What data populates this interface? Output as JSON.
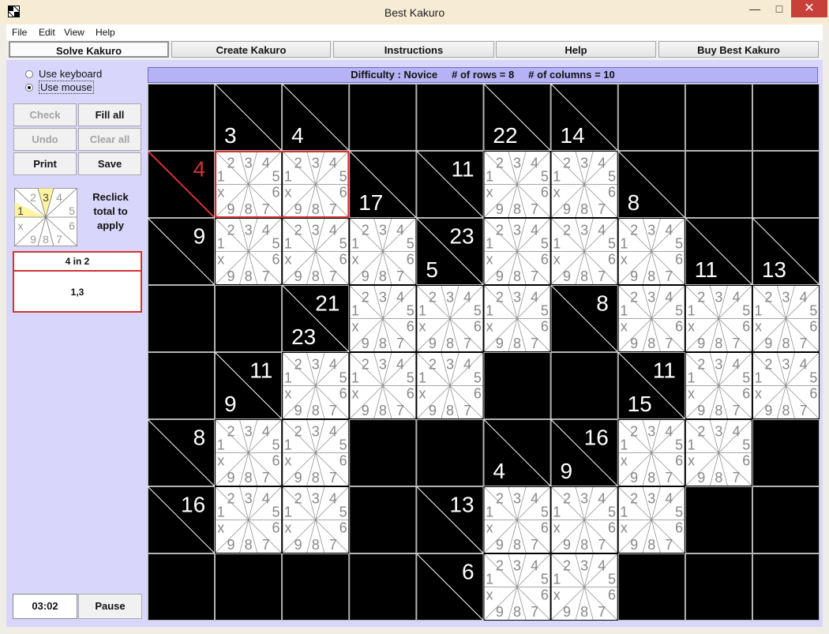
{
  "window": {
    "title": "Best Kakuro",
    "min_glyph": "—",
    "max_glyph": "□",
    "close_glyph": "✕"
  },
  "menu": [
    "File",
    "Edit",
    "View",
    "Help"
  ],
  "tabs": [
    "Solve Kakuro",
    "Create Kakuro",
    "Instructions",
    "Help",
    "Buy Best Kakuro"
  ],
  "input_mode": {
    "keyboard": "Use keyboard",
    "mouse": "Use mouse",
    "selected": "mouse"
  },
  "buttons": {
    "check": "Check",
    "fill_all": "Fill all",
    "undo": "Undo",
    "clear_all": "Clear all",
    "print": "Print",
    "save": "Save",
    "pause": "Pause"
  },
  "reclick_text": [
    "Reclick",
    "total to",
    "apply"
  ],
  "combo": {
    "title": "4 in 2",
    "combos": "1,3"
  },
  "timer": "03:02",
  "info": {
    "difficulty": "Difficulty : Novice",
    "rows": "# of rows = 8",
    "cols": "# of columns = 10"
  },
  "wheel_digits": {
    "top": [
      "2",
      "3",
      "4"
    ],
    "right": [
      "5",
      "6"
    ],
    "bottom": [
      "9",
      "8",
      "7"
    ],
    "left": [
      "1",
      "x"
    ]
  },
  "mini_wheel_highlight": [
    "1",
    "3"
  ],
  "colors": {
    "panel": "#d8d6fb",
    "info_bar": "#b5b3f5",
    "selected": "#d23333",
    "highlight": "#fef4a0"
  },
  "grid": {
    "rows": 8,
    "cols": 10,
    "cells": [
      [
        "B",
        "C::3",
        "C::4",
        "B",
        "B",
        "C::22",
        "C::14",
        "B",
        "B",
        "B"
      ],
      [
        "C:4:",
        "W",
        "W",
        "C::17",
        "C:11:",
        "W",
        "W",
        "C::8",
        "B",
        "B"
      ],
      [
        "C:9:",
        "W",
        "W",
        "W",
        "C:23:5",
        "W",
        "W",
        "W",
        "C::11",
        "C::13"
      ],
      [
        "B",
        "B",
        "C:21:23",
        "W",
        "W",
        "W",
        "C:8:",
        "W",
        "W",
        "W"
      ],
      [
        "B",
        "C:11:9",
        "W",
        "W",
        "W",
        "B",
        "B",
        "C:11:15",
        "W",
        "W"
      ],
      [
        "C:8:",
        "W",
        "W",
        "B",
        "B",
        "C::4",
        "C:16:9",
        "W",
        "W",
        "B"
      ],
      [
        "C:16:",
        "W",
        "W",
        "B",
        "C:13:",
        "W",
        "W",
        "W",
        "B",
        "B"
      ],
      [
        "B",
        "B",
        "B",
        "B",
        "C:6:",
        "W",
        "W",
        "B",
        "B",
        "B"
      ]
    ],
    "selected": {
      "row": 1,
      "col": 0
    },
    "selected_run": [
      [
        1,
        1
      ],
      [
        1,
        2
      ]
    ]
  }
}
